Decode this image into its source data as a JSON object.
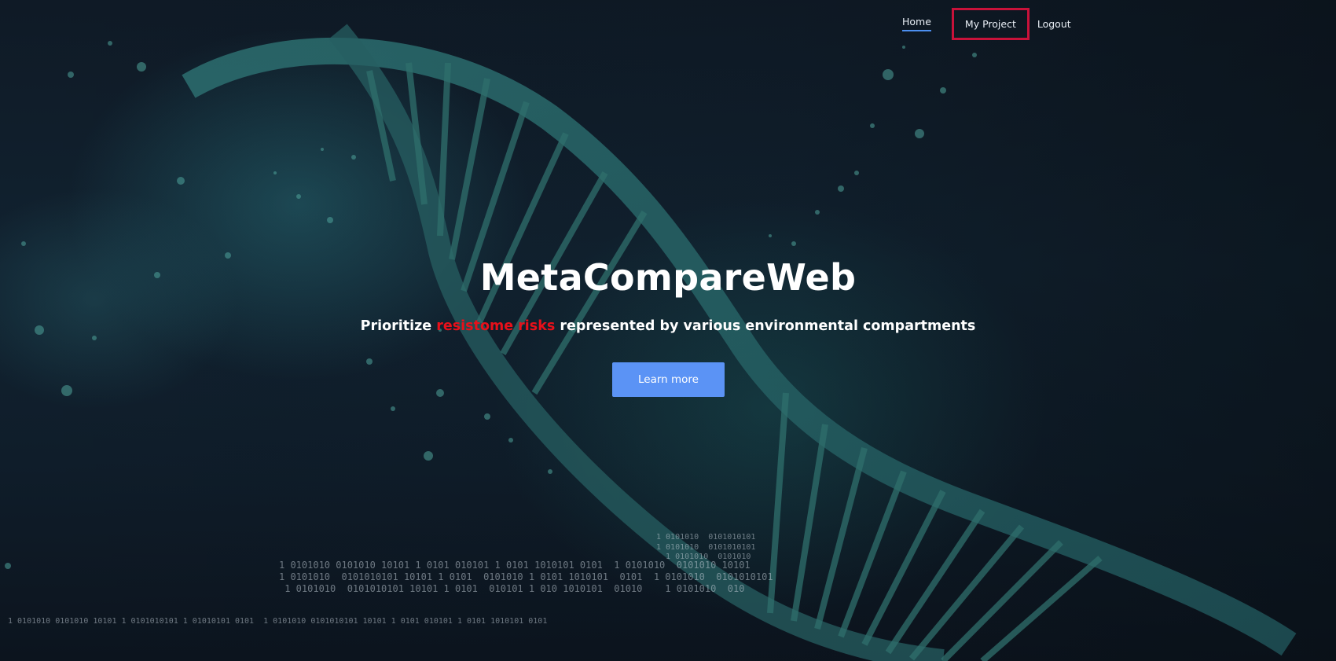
{
  "nav": {
    "items": [
      {
        "label": "Home",
        "active": true
      },
      {
        "label": "My Project",
        "highlighted": true
      },
      {
        "label": "Logout"
      }
    ]
  },
  "hero": {
    "title": "MetaCompareWeb",
    "subtitle_before": "Prioritize ",
    "subtitle_highlight": "resistome risks",
    "subtitle_after": " represented by various environmental compartments",
    "cta_label": "Learn more"
  },
  "colors": {
    "accent": "#5b93f5",
    "highlight_text": "#e8101a",
    "nav_highlight_border": "#c8123a",
    "active_underline": "#4c8ff0"
  }
}
